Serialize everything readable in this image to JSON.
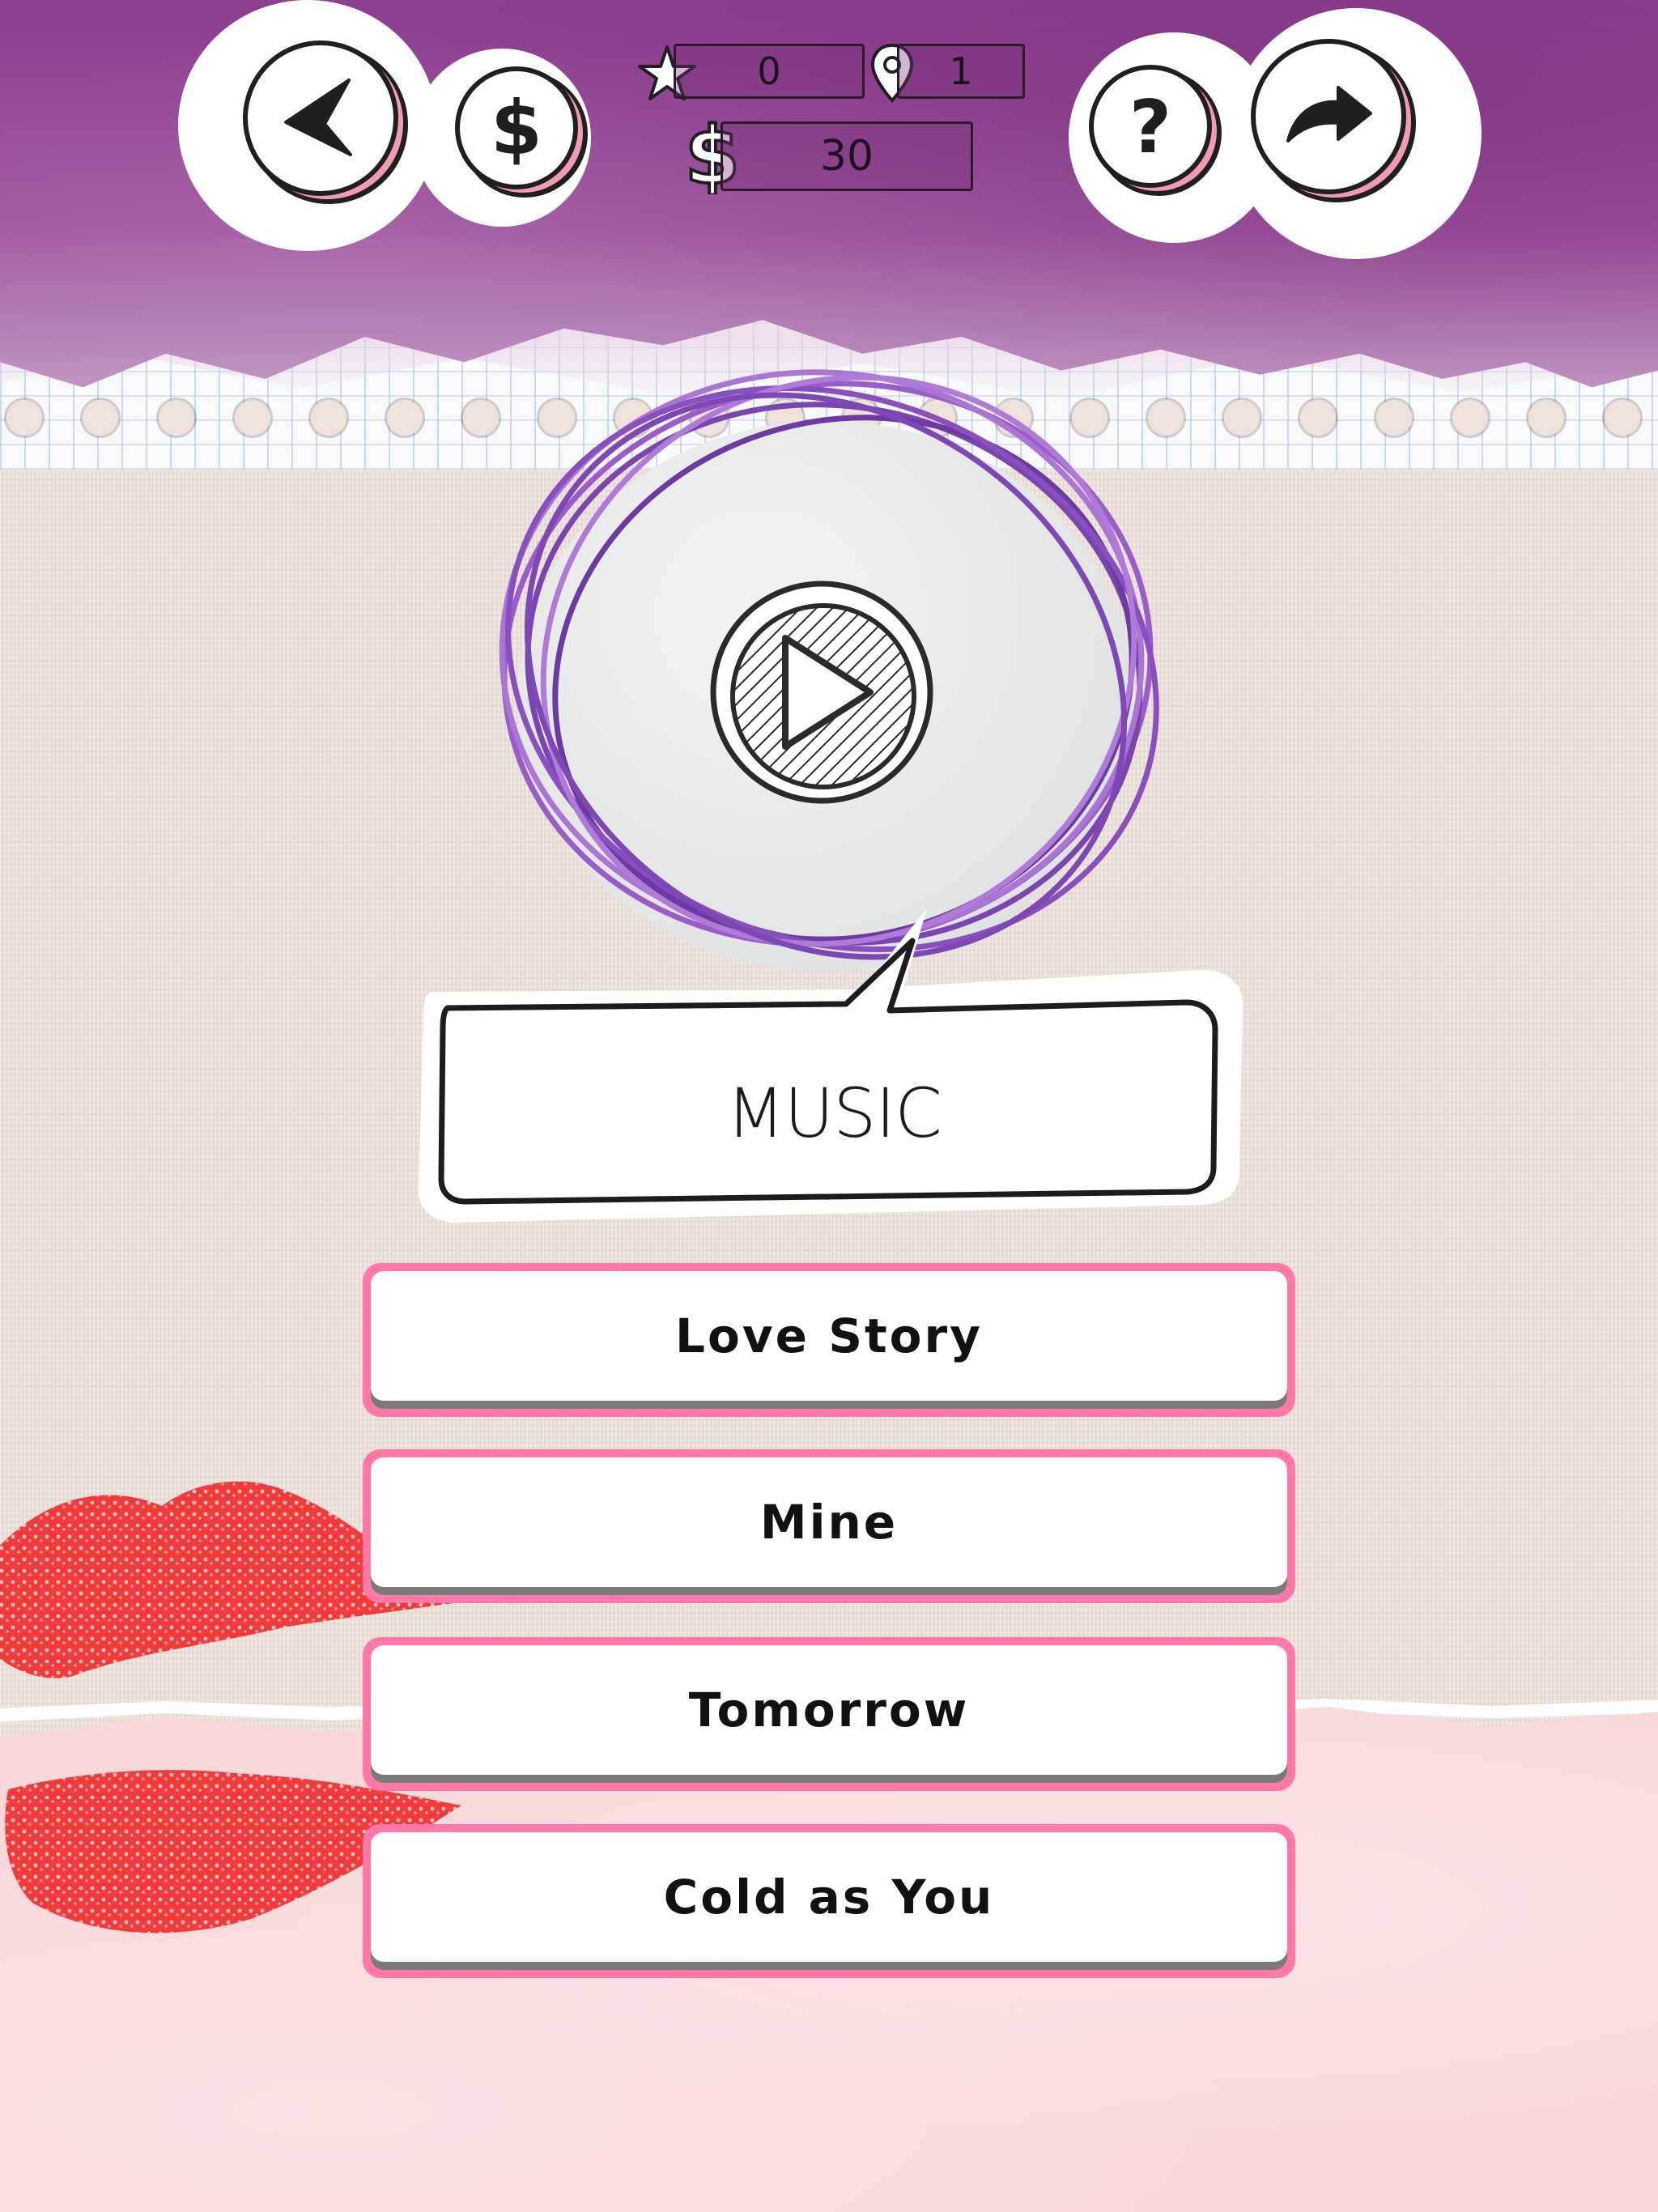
{
  "hud": {
    "back_icon": "back-arrow-icon",
    "shop_icon": "dollar-icon",
    "help_icon": "question-mark-icon",
    "share_icon": "share-arrow-icon",
    "stars": "0",
    "level": "1",
    "coins": "30"
  },
  "quiz": {
    "category": "MUSIC",
    "play_icon": "play-icon",
    "answers": [
      "Love Story",
      "Mine",
      "Tomorrow",
      "Cold as You"
    ]
  },
  "colors": {
    "header_purple": "#8d3f8f",
    "answer_border": "#ff78a8",
    "scribble_purple": "#8a4fbf",
    "footer_pink": "#f9d8da"
  }
}
